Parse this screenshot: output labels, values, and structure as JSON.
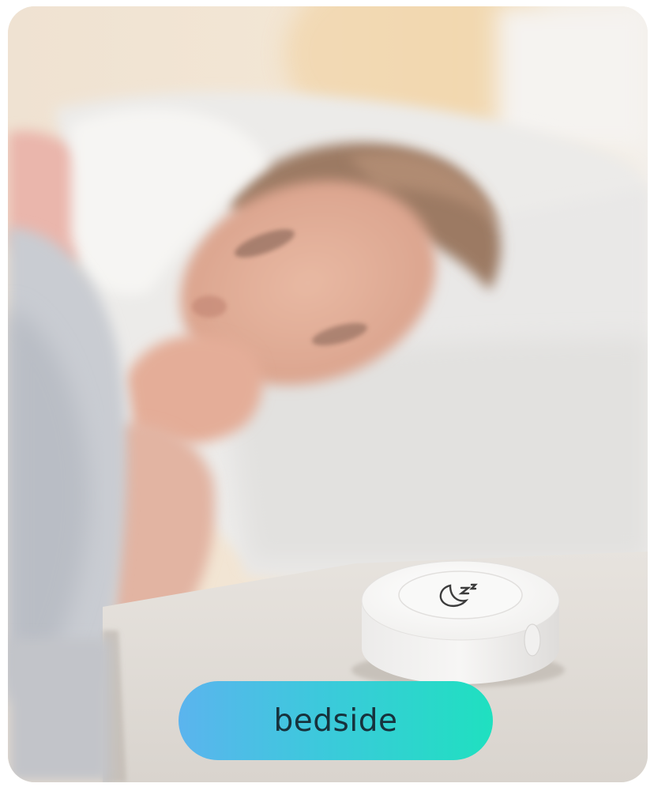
{
  "scene": {
    "subject": "person-sleeping-in-bed",
    "device": "round-white-smart-button"
  },
  "device": {
    "button_icon": "moon-sleep-icon"
  },
  "label": {
    "text": "bedside"
  },
  "colors": {
    "pill_gradient_start": "#5bb4ee",
    "pill_gradient_end": "#1fe0c0",
    "label_text": "#17323d"
  }
}
